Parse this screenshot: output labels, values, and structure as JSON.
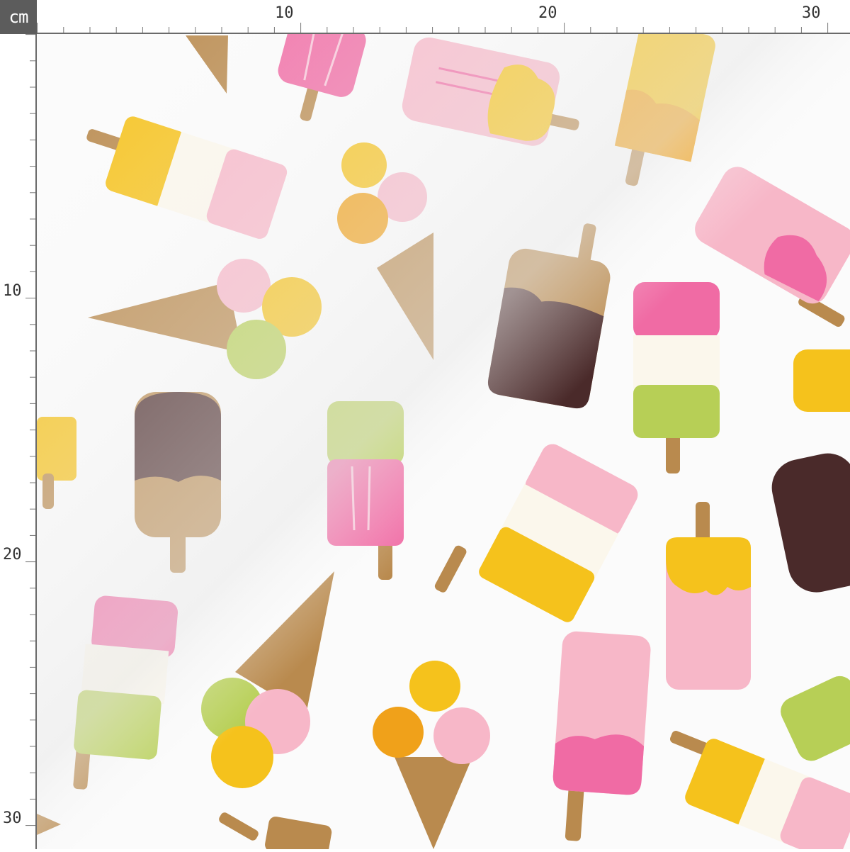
{
  "ruler": {
    "unit": "cm",
    "top_labels": [
      "10",
      "20",
      "30"
    ],
    "left_labels": [
      "10",
      "20",
      "30"
    ]
  },
  "fabric": {
    "description_colors": {
      "background": "#fbfbfb",
      "pink": "#f06ba4",
      "light_pink": "#f7b7c8",
      "yellow": "#f5c21c",
      "orange": "#f0a11a",
      "green": "#b7cf56",
      "chocolate": "#4a2a2a",
      "cone": "#b98a4e",
      "stick": "#b98a4e",
      "cream": "#fbf7ec"
    }
  }
}
